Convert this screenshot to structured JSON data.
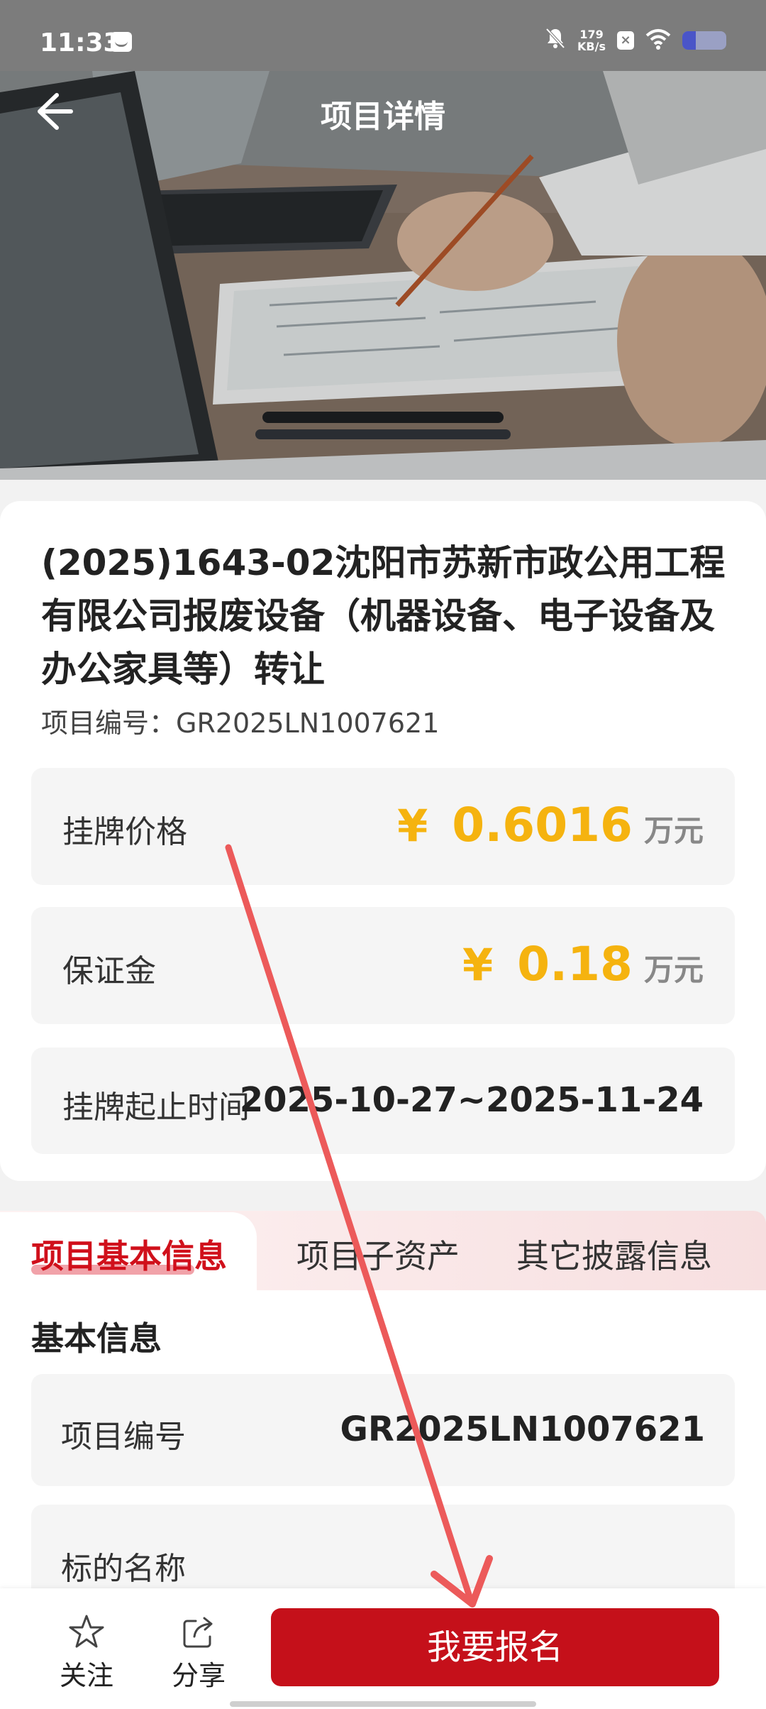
{
  "status_bar": {
    "time": "11:33",
    "net_speed_value": "179",
    "net_speed_unit": "KB/s",
    "icons": [
      "message-icon",
      "bell-mute-icon",
      "x-icon",
      "wifi-icon",
      "battery-icon"
    ],
    "battery_level": 0.3
  },
  "nav": {
    "title": "项目详情",
    "back_icon": "arrow-left-icon"
  },
  "project": {
    "title": "(2025)1643-02沈阳市苏新市政公用工程有限公司报废设备（机器设备、电子设备及办公家具等）转让",
    "code_line": "项目编号：GR2025LN1007621",
    "listing_price_label": "挂牌价格",
    "listing_price_symbol": "¥",
    "listing_price_value": "0.6016",
    "listing_price_unit": "万元",
    "deposit_label": "保证金",
    "deposit_symbol": "¥",
    "deposit_value": "0.18",
    "deposit_unit": "万元",
    "period_label": "挂牌起止时间",
    "period_value": "2025-10-27~2025-11-24"
  },
  "tabs": [
    {
      "label": "项目基本信息",
      "active": true
    },
    {
      "label": "项目子资产",
      "active": false
    },
    {
      "label": "其它披露信息",
      "active": false
    }
  ],
  "basic_info": {
    "section_title": "基本信息",
    "rows": [
      {
        "label": "项目编号",
        "value": "GR2025LN1007621"
      },
      {
        "label": "标的名称",
        "value": ""
      }
    ]
  },
  "bottom_bar": {
    "follow_label": "关注",
    "follow_icon": "star-icon",
    "share_label": "分享",
    "share_icon": "share-icon",
    "signup_label": "我要报名"
  },
  "colors": {
    "accent_red": "#c5101a",
    "price_gold": "#f5b30f",
    "annotation_arrow": "#ec5a5a"
  }
}
